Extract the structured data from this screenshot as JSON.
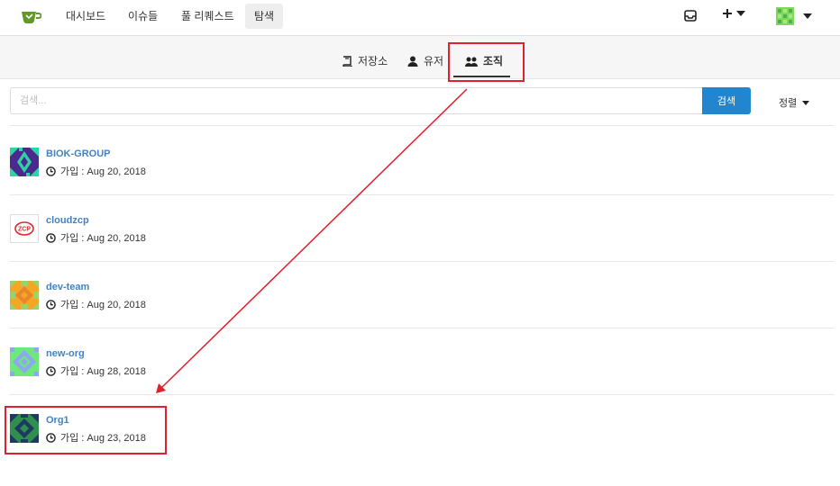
{
  "nav": {
    "items": [
      "대시보드",
      "이슈들",
      "풀 리퀘스트",
      "탐색"
    ],
    "logo_icon": "tea-cup-logo-icon",
    "inbox_icon": "inbox-icon",
    "plus_icon": "plus-icon",
    "avatar_icon": "user-avatar"
  },
  "tabs": [
    {
      "label": "저장소",
      "icon": "book-icon"
    },
    {
      "label": "유저",
      "icon": "person-icon"
    },
    {
      "label": "조직",
      "icon": "organization-icon"
    }
  ],
  "search": {
    "placeholder": "검색...",
    "button_label": "검색",
    "sort_label": "정렬"
  },
  "orgs": [
    {
      "name": "BIOK-GROUP",
      "joined": "가입 : Aug 20, 2018"
    },
    {
      "name": "cloudzcp",
      "joined": "가입 : Aug 20, 2018",
      "avatar_text": "ZCP"
    },
    {
      "name": "dev-team",
      "joined": "가입 : Aug 20, 2018"
    },
    {
      "name": "new-org",
      "joined": "가입 : Aug 28, 2018"
    },
    {
      "name": "Org1",
      "joined": "가입 : Aug 23, 2018"
    }
  ],
  "colors": {
    "accent": "#2185d0",
    "link": "#4183c4",
    "annotation": "#e0202c"
  }
}
